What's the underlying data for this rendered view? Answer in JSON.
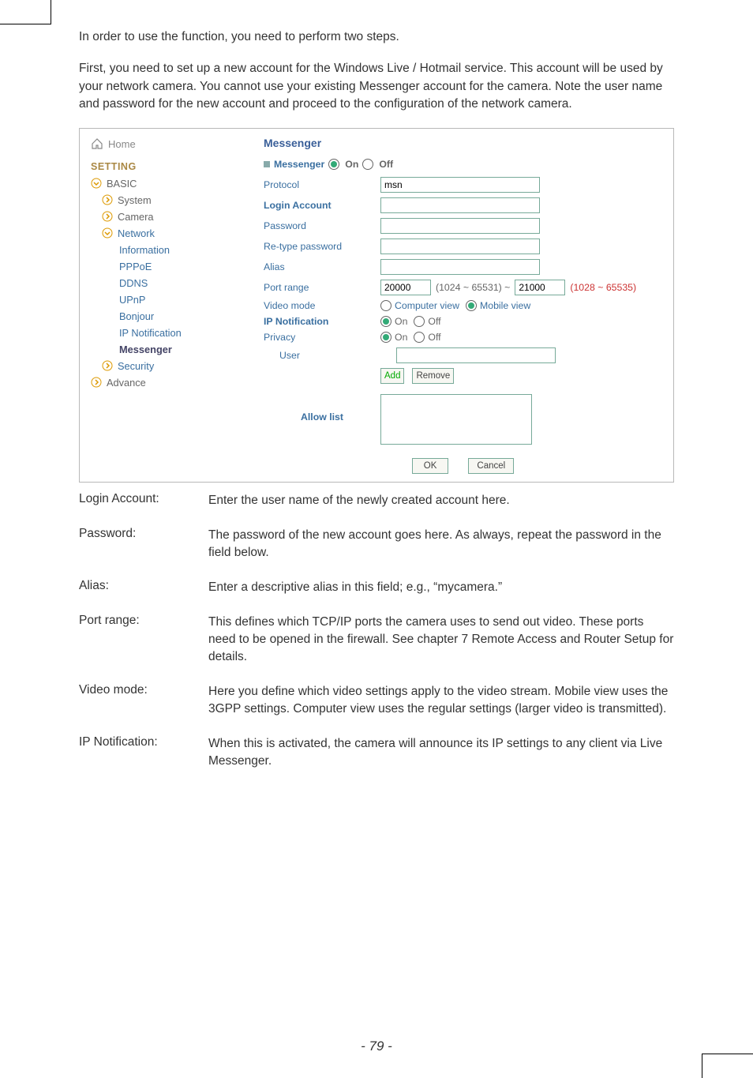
{
  "intro": {
    "p1": "In order to use the function, you need to perform two steps.",
    "p2": "First, you need to set up a new account for the Windows Live / Hotmail service. This account will be used by your network camera. You cannot use your existing Messenger account for the camera. Note the user name and password for the new account and proceed to the configuration of the network camera."
  },
  "nav": {
    "home": "Home",
    "setting": "SETTING",
    "basic": "BASIC",
    "system": "System",
    "camera": "Camera",
    "network": "Network",
    "information": "Information",
    "pppoe": "PPPoE",
    "ddns": "DDNS",
    "upnp": "UPnP",
    "bonjour": "Bonjour",
    "ipnotif": "IP Notification",
    "messenger": "Messenger",
    "security": "Security",
    "advance": "Advance"
  },
  "form": {
    "title": "Messenger",
    "section_label": "Messenger",
    "on": "On",
    "off": "Off",
    "protocol": "Protocol",
    "protocol_value": "msn",
    "login_account": "Login Account",
    "login_account_value": "",
    "password": "Password",
    "password_value": "",
    "retype": "Re-type password",
    "retype_value": "",
    "alias": "Alias",
    "alias_value": "",
    "port_range": "Port range",
    "port1": "20000",
    "port_between": "(1024 ~ 65531) ~",
    "port2": "21000",
    "port_suffix": "(1028 ~ 65535)",
    "video_mode": "Video mode",
    "vm_computer": "Computer view",
    "vm_mobile": "Mobile view",
    "ip_notif_lbl": "IP Notification",
    "privacy": "Privacy",
    "user": "User",
    "user_value": "",
    "add": "Add",
    "remove": "Remove",
    "allow_list": "Allow list",
    "ok": "OK",
    "cancel": "Cancel"
  },
  "defs": {
    "login_k": "Login Account:",
    "login_v": "Enter the user name of the newly created account here.",
    "password_k": "Password:",
    "password_v": "The password of the new account goes here. As always, repeat the password in the field below.",
    "alias_k": "Alias:",
    "alias_v": "Enter a descriptive alias in this field; e.g., “mycamera.”",
    "port_k": "Port range:",
    "port_v": "This defines which TCP/IP ports the camera uses to send out video. These ports need to be opened in the firewall. See chapter 7 Remote Access and Router Setup for details.",
    "video_k": "Video mode:",
    "video_v": "Here you define which video settings apply to the video stream. Mobile view uses the 3GPP settings. Computer view uses the regular settings (larger video is transmitted).",
    "ipn_k": "IP Notification:",
    "ipn_v": "When this is activated, the camera will announce its IP settings to any client via Live Messenger."
  },
  "footer": {
    "page": "- 79 -"
  }
}
